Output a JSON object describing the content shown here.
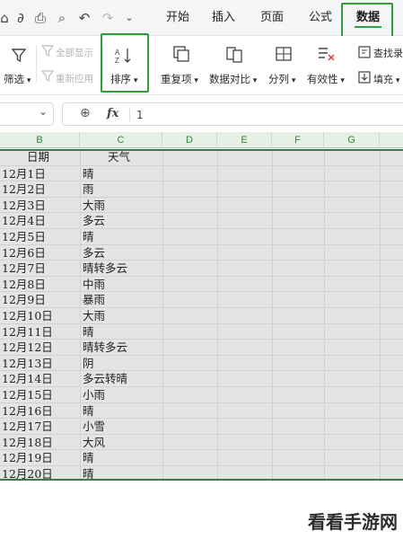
{
  "tabs": [
    {
      "label": "开始"
    },
    {
      "label": "插入"
    },
    {
      "label": "页面"
    },
    {
      "label": "公式"
    },
    {
      "label": "数据",
      "active": true
    }
  ],
  "ribbon": {
    "filter_label": "筛选",
    "show_all_label": "全部显示",
    "reapply_label": "重新应用",
    "sort_label": "排序",
    "duplicates_label": "重复项",
    "compare_label": "数据对比",
    "split_label": "分列",
    "validity_label": "有效性",
    "find_label": "查找录",
    "fill_label": "填充"
  },
  "formula_bar": {
    "fx_symbol": "fx",
    "content": "1"
  },
  "columns": [
    "B",
    "C",
    "D",
    "E",
    "F",
    "G"
  ],
  "header_row": {
    "date": "日期",
    "weather": "天气"
  },
  "rows": [
    {
      "date": "12月1日",
      "weather": "晴"
    },
    {
      "date": "12月2日",
      "weather": "雨"
    },
    {
      "date": "12月3日",
      "weather": "大雨"
    },
    {
      "date": "12月4日",
      "weather": "多云"
    },
    {
      "date": "12月5日",
      "weather": "晴"
    },
    {
      "date": "12月6日",
      "weather": "多云"
    },
    {
      "date": "12月7日",
      "weather": "晴转多云"
    },
    {
      "date": "12月8日",
      "weather": "中雨"
    },
    {
      "date": "12月9日",
      "weather": "暴雨"
    },
    {
      "date": "12月10日",
      "weather": "大雨"
    },
    {
      "date": "12月11日",
      "weather": "晴"
    },
    {
      "date": "12月12日",
      "weather": "晴转多云"
    },
    {
      "date": "12月13日",
      "weather": "阴"
    },
    {
      "date": "12月14日",
      "weather": "多云转晴"
    },
    {
      "date": "12月15日",
      "weather": "小雨"
    },
    {
      "date": "12月16日",
      "weather": "晴"
    },
    {
      "date": "12月17日",
      "weather": "小雪"
    },
    {
      "date": "12月18日",
      "weather": "大风"
    },
    {
      "date": "12月19日",
      "weather": "晴"
    },
    {
      "date": "12月20日",
      "weather": "晴"
    }
  ],
  "watermark": "看看手游网",
  "colors": {
    "highlight_green": "#2e9e3a",
    "selection_gray": "#e4e4e4",
    "header_green": "#2a8a3a"
  }
}
